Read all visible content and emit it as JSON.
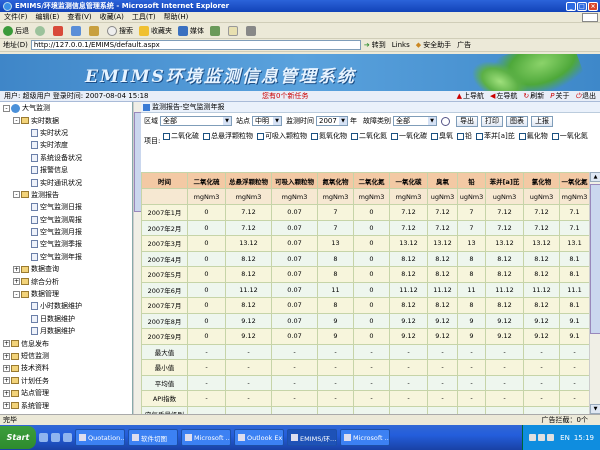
{
  "window": {
    "title": "EMIMS/环境监测信息管理系统 - Microsoft Internet Explorer",
    "btn_min": "_",
    "btn_max": "□",
    "btn_close": "×"
  },
  "menu": [
    "文件(F)",
    "编辑(E)",
    "查看(V)",
    "收藏(A)",
    "工具(T)",
    "帮助(H)"
  ],
  "toolbar": {
    "back": "后退",
    "search": "搜索",
    "favorites": "收藏夹",
    "media": "媒体"
  },
  "address": {
    "label": "地址(D)",
    "url": "http://127.0.0.1/EMIMS/default.aspx",
    "go": "转到",
    "links": "Links",
    "safe": "安全助手",
    "ad": "广告"
  },
  "banner": {
    "title": "EMIMS环境监测信息管理系统"
  },
  "infobar": {
    "user": "用户: 超级用户  登录时间: 2007-08-04 15:18",
    "tasks": "您有0个新任务",
    "nav": [
      "上导航",
      "左导航",
      "刷新",
      "关于",
      "退出"
    ]
  },
  "sidebar": [
    {
      "label": "大气监测",
      "level": 0,
      "type": "root",
      "exp": "-"
    },
    {
      "label": "实时数据",
      "level": 1,
      "type": "folder",
      "exp": "-"
    },
    {
      "label": "实时状况",
      "level": 2,
      "type": "doc"
    },
    {
      "label": "实时浓度",
      "level": 2,
      "type": "doc"
    },
    {
      "label": "系统设备状况",
      "level": 2,
      "type": "doc"
    },
    {
      "label": "报警信息",
      "level": 2,
      "type": "doc"
    },
    {
      "label": "实时通讯状况",
      "level": 2,
      "type": "doc"
    },
    {
      "label": "监测报告",
      "level": 1,
      "type": "folder",
      "exp": "-"
    },
    {
      "label": "空气监测日报",
      "level": 2,
      "type": "doc"
    },
    {
      "label": "空气监测周报",
      "level": 2,
      "type": "doc"
    },
    {
      "label": "空气监测月报",
      "level": 2,
      "type": "doc"
    },
    {
      "label": "空气监测季报",
      "level": 2,
      "type": "doc"
    },
    {
      "label": "空气监测年报",
      "level": 2,
      "type": "doc"
    },
    {
      "label": "数据查询",
      "level": 1,
      "type": "folder",
      "exp": "+"
    },
    {
      "label": "综合分析",
      "level": 1,
      "type": "folder",
      "exp": "+"
    },
    {
      "label": "数据管理",
      "level": 1,
      "type": "folder",
      "exp": "-"
    },
    {
      "label": "小时数据维护",
      "level": 2,
      "type": "doc"
    },
    {
      "label": "日数据维护",
      "level": 2,
      "type": "doc"
    },
    {
      "label": "月数据维护",
      "level": 2,
      "type": "doc"
    },
    {
      "label": "信息发布",
      "level": 0,
      "type": "folder",
      "exp": "+"
    },
    {
      "label": "短信监测",
      "level": 0,
      "type": "folder",
      "exp": "+"
    },
    {
      "label": "技术资料",
      "level": 0,
      "type": "folder",
      "exp": "+"
    },
    {
      "label": "计划任务",
      "level": 0,
      "type": "folder",
      "exp": "+"
    },
    {
      "label": "站点管理",
      "level": 0,
      "type": "folder",
      "exp": "+"
    },
    {
      "label": "系统管理",
      "level": 0,
      "type": "folder",
      "exp": "+"
    }
  ],
  "crumb": "监测报告-空气监测年报",
  "filter": {
    "region_label": "区域",
    "region_value": "全部",
    "site_label": "站点",
    "site_value": "中明",
    "year_label": "监测时间",
    "year_value": "2007",
    "year_unit": "年",
    "type_label": "故障类别",
    "type_value": "全部",
    "buttons": [
      "导出",
      "打印",
      "图表",
      "上报"
    ]
  },
  "items": {
    "label": "项目:",
    "list": [
      "二氧化硫",
      "总悬浮颗粒物",
      "可吸入颗粒物",
      "氮氧化物",
      "二氧化氮",
      "一氧化碳",
      "臭氧",
      "铅",
      "苯并[a]芘",
      "氟化物",
      "一氧化氮"
    ]
  },
  "table": {
    "headers": [
      "时间",
      "二氧化硫",
      "总悬浮颗粒物",
      "可吸入颗粒物",
      "氮氧化物",
      "二氧化氮",
      "一氧化碳",
      "臭氧",
      "铅",
      "苯并[a]芘",
      "氯化物",
      "一氧化氮"
    ],
    "units": [
      "",
      "mgNm3",
      "mgNm3",
      "mgNm3",
      "mgNm3",
      "mgNm3",
      "mgNm3",
      "ugNm3",
      "ugNm3",
      "ugNm3",
      "ugNm3",
      "mgNm3"
    ],
    "rows": [
      [
        "2007年1月",
        "0",
        "7.12",
        "0.07",
        "7",
        "0",
        "7.12",
        "7.12",
        "7",
        "7.12",
        "7.12",
        "7.1"
      ],
      [
        "2007年2月",
        "0",
        "7.12",
        "0.07",
        "7",
        "0",
        "7.12",
        "7.12",
        "7",
        "7.12",
        "7.12",
        "7.1"
      ],
      [
        "2007年3月",
        "0",
        "13.12",
        "0.07",
        "13",
        "0",
        "13.12",
        "13.12",
        "13",
        "13.12",
        "13.12",
        "13.1"
      ],
      [
        "2007年4月",
        "0",
        "8.12",
        "0.07",
        "8",
        "0",
        "8.12",
        "8.12",
        "8",
        "8.12",
        "8.12",
        "8.1"
      ],
      [
        "2007年5月",
        "0",
        "8.12",
        "0.07",
        "8",
        "0",
        "8.12",
        "8.12",
        "8",
        "8.12",
        "8.12",
        "8.1"
      ],
      [
        "2007年6月",
        "0",
        "11.12",
        "0.07",
        "11",
        "0",
        "11.12",
        "11.12",
        "11",
        "11.12",
        "11.12",
        "11.1"
      ],
      [
        "2007年7月",
        "0",
        "8.12",
        "0.07",
        "8",
        "0",
        "8.12",
        "8.12",
        "8",
        "8.12",
        "8.12",
        "8.1"
      ],
      [
        "2007年8月",
        "0",
        "9.12",
        "0.07",
        "9",
        "0",
        "9.12",
        "9.12",
        "9",
        "9.12",
        "9.12",
        "9.1"
      ],
      [
        "2007年9月",
        "0",
        "9.12",
        "0.07",
        "9",
        "0",
        "9.12",
        "9.12",
        "9",
        "9.12",
        "9.12",
        "9.1"
      ],
      [
        "最大值",
        "-",
        "-",
        "-",
        "-",
        "-",
        "-",
        "-",
        "-",
        "-",
        "-",
        "-"
      ],
      [
        "最小值",
        "-",
        "-",
        "-",
        "-",
        "-",
        "-",
        "-",
        "-",
        "-",
        "-",
        "-"
      ],
      [
        "平均值",
        "-",
        "-",
        "-",
        "-",
        "-",
        "-",
        "-",
        "-",
        "-",
        "-",
        "-"
      ],
      [
        "API指数",
        "-",
        "-",
        "-",
        "-",
        "-",
        "-",
        "-",
        "-",
        "-",
        "-",
        "-"
      ],
      [
        "空气质量级别",
        "-",
        "-",
        "-",
        "-",
        "-",
        "-",
        "-",
        "-",
        "-",
        "-",
        "-"
      ]
    ]
  },
  "status": {
    "left": "完毕",
    "right": "广告拦截：0个"
  },
  "taskbar": {
    "start": "Start",
    "tasks": [
      "Quotation...",
      "软件切图",
      "Microsoft ...",
      "Outlook Ex...",
      "EMIMS/环...",
      "Microsoft ..."
    ],
    "active_index": 4,
    "lang": "EN",
    "clock": "15:19"
  }
}
